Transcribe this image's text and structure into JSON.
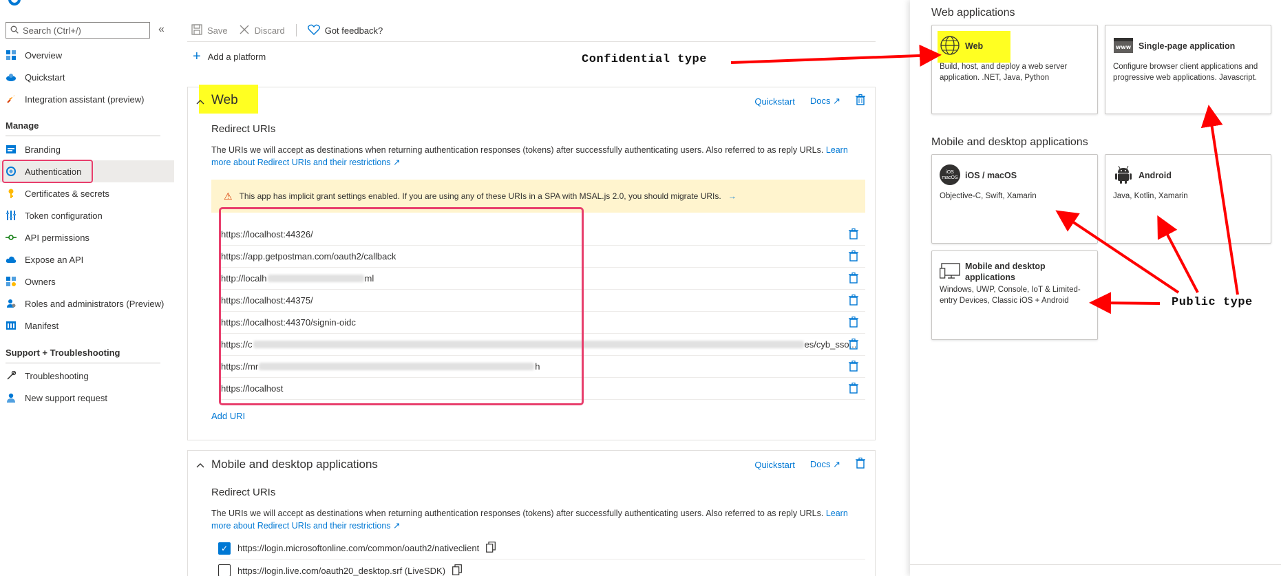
{
  "search": {
    "placeholder": "Search (Ctrl+/)"
  },
  "collapse_glyph": "«",
  "nav": {
    "top_items": [
      {
        "label": "Overview",
        "icon": "overview-icon"
      },
      {
        "label": "Quickstart",
        "icon": "quickstart-icon"
      },
      {
        "label": "Integration assistant (preview)",
        "icon": "rocket-icon"
      }
    ],
    "manage_heading": "Manage",
    "manage_items": [
      {
        "label": "Branding",
        "icon": "branding-icon"
      },
      {
        "label": "Authentication",
        "icon": "authentication-icon",
        "active": true
      },
      {
        "label": "Certificates & secrets",
        "icon": "key-icon"
      },
      {
        "label": "Token configuration",
        "icon": "token-icon"
      },
      {
        "label": "API permissions",
        "icon": "permissions-icon"
      },
      {
        "label": "Expose an API",
        "icon": "cloud-icon"
      },
      {
        "label": "Owners",
        "icon": "owners-icon"
      },
      {
        "label": "Roles and administrators (Preview)",
        "icon": "roles-icon"
      },
      {
        "label": "Manifest",
        "icon": "manifest-icon"
      }
    ],
    "support_heading": "Support + Troubleshooting",
    "support_items": [
      {
        "label": "Troubleshooting",
        "icon": "wrench-icon"
      },
      {
        "label": "New support request",
        "icon": "support-person-icon"
      }
    ]
  },
  "toolbar": {
    "save_label": "Save",
    "discard_label": "Discard",
    "feedback_label": "Got feedback?"
  },
  "add_platform_label": "Add a platform",
  "web_card": {
    "title": "Web",
    "quickstart_label": "Quickstart",
    "docs_label": "Docs",
    "redirect_title": "Redirect URIs",
    "desc_text": "The URIs we will accept as destinations when returning authentication responses (tokens) after successfully authenticating users. Also referred to as reply URLs.",
    "desc_link": "Learn more about Redirect URIs and their restrictions",
    "warning": "This app has implicit grant settings enabled. If you are using any of these URIs in a SPA with MSAL.js 2.0, you should migrate URIs.",
    "uris": [
      {
        "pre": "https://localhost:44326/",
        "post": ""
      },
      {
        "pre": "https://app.getpostman.com/oauth2/callback",
        "post": ""
      },
      {
        "pre": "http://localh",
        "post": "ml"
      },
      {
        "pre": "https://localhost:44375/",
        "post": ""
      },
      {
        "pre": "https://localhost:44370/signin-oidc",
        "post": ""
      },
      {
        "pre": "https://c",
        "post": "es/cyb_sso..."
      },
      {
        "pre": "https://mr",
        "post": "h"
      },
      {
        "pre": "https://localhost",
        "post": ""
      }
    ],
    "add_uri_label": "Add URI"
  },
  "mobile_card": {
    "title": "Mobile and desktop applications",
    "quickstart_label": "Quickstart",
    "docs_label": "Docs",
    "redirect_title": "Redirect URIs",
    "desc_text": "The URIs we will accept as destinations when returning authentication responses (tokens) after successfully authenticating users. Also referred to as reply URLs.",
    "desc_link": "Learn more about Redirect URIs and their restrictions",
    "uris": [
      {
        "label": "https://login.microsoftonline.com/common/oauth2/nativeclient",
        "checked": true
      },
      {
        "label": "https://login.live.com/oauth20_desktop.srf (LiveSDK)",
        "checked": false
      }
    ]
  },
  "flyout": {
    "web_group_title": "Web applications",
    "mobile_group_title": "Mobile and desktop applications",
    "platforms": [
      {
        "name": "Web",
        "desc": "Build, host, and deploy a web server application. .NET, Java, Python",
        "icon": "globe-icon"
      },
      {
        "name": "Single-page application",
        "desc": "Configure browser client applications and progressive web applications. Javascript.",
        "icon": "www-icon"
      },
      {
        "name": "iOS / macOS",
        "desc": "Objective-C, Swift, Xamarin",
        "icon": "ios-macos-icon",
        "icon_text": "iOS macOS"
      },
      {
        "name": "Android",
        "desc": "Java, Kotlin, Xamarin",
        "icon": "android-icon"
      },
      {
        "name": "Mobile and desktop applications",
        "desc": "Windows, UWP, Console, IoT & Limited-entry Devices, Classic iOS + Android",
        "icon": "desktop-icon"
      }
    ]
  },
  "annotations": {
    "confidential": "Confidential type",
    "public": "Public type"
  },
  "colors": {
    "accent": "#0078d4",
    "highlight": "#ffff22",
    "annotation_box": "#e83e6c",
    "arrow": "#ff0000"
  }
}
